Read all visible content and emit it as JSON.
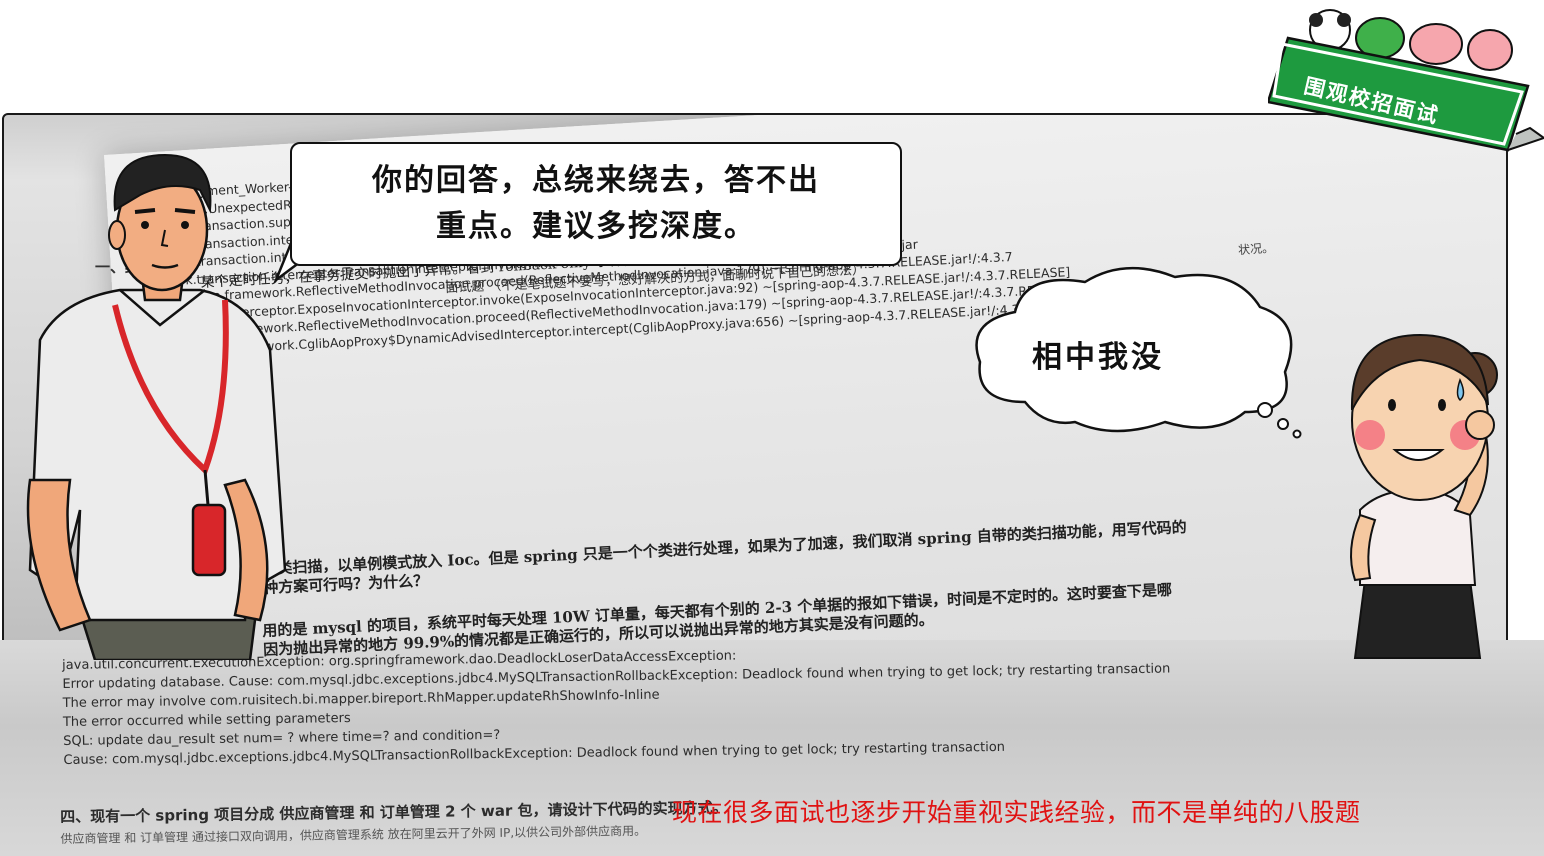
{
  "speech_bubble": {
    "line1": "你的回答，总绕来绕去，答不出",
    "line2": "重点。建议多挖深度。"
  },
  "thought_bubble": {
    "text": "相中我没"
  },
  "badge": {
    "text": "围观校招面试",
    "color": "#1e9a3f"
  },
  "caption": {
    "text": "现在很多面试也逐步开始重视实践经验，而不是单纯的八股题",
    "color": "#e01212"
  },
  "document": {
    "title": "面试题  （不是笔试题不要写，想好解决的方式，面聊时说下自己的想法）",
    "section1_label": "一、结",
    "section1_text": "某个定时任务，在事务提交时抛出了异常。看到 rollback-only 字样，这个是什么原因引起的。写代码",
    "year": "2017",
    "stray_right": "状况。",
    "log_lines": [
      "132 [payment_Worker-2] ERROR com.lianjia.payment.job.bill.BillJobService.execute(BillJobService.java:39) [9000020_26",
      "nsaction.UnexpectedRollbackException: Transaction rolled back because it has been marked as rollback-only",
      "ework.transaction.support.AbstractPlatformTransactionManager.commit(AbstractPlatformTransactionManager.java",
      "ework.transaction.interceptor.TransactionAspectSupport.commitTransactionAfterReturning(TransactionAspectSupp",
      "ework.transaction.interceptor.TransactionAspectSupport.invokeWithinTransaction(TransactionAspectSupport.java:29",
      "ework.transaction.interceptor.TransactionInterceptor.invoke(TransactionInterceptor.java:96) ~[spring-tx-4.3.7.RELEASE.jar",
      "ework.aop.framework.ReflectiveMethodInvocation.proceed(ReflectiveMethodInvocation.java:179) ~[spring-aop-4.3.7.RELEASE.jar!/:4.3.7",
      "ework.aop.interceptor.ExposeInvocationInterceptor.invoke(ExposeInvocationInterceptor.java:92) ~[spring-aop-4.3.7.RELEASE.jar!/:4.3.7.RELEASE]",
      "ework.aop.framework.ReflectiveMethodInvocation.proceed(ReflectiveMethodInvocation.java:179) ~[spring-aop-4.3.7.RELEASE.jar!/:4.3.7.RELEASE]",
      "ework.aop.framework.CglibAopProxy$DynamicAdvisedInterceptor.intercept(CglibAopProxy.java:656) ~[spring-aop-4.3.7.RELEASE.jar!/:4.3.7.RELEASE]"
    ],
    "question2_lines": [
      "做类扫描，以单例模式放入 Ioc。但是 spring 只是一个个类进行处理，如果为了加速，我们取消 spring 自带的类扫描功能，用写代码的",
      "种方案可行吗？为什么？"
    ],
    "question3_lines": [
      "用的是 mysql 的项目，系统平时每天处理 10W 订单量，每天都有个别的 2-3 个单据的报如下错误，时间是不定时的。这时要查下是哪",
      "因为抛出异常的地方 99.9%的情况都是正确运行的，所以可以说抛出异常的地方其实是没有问题的。"
    ],
    "error_lines": [
      "java.util.concurrent.ExecutionException: org.springframework.dao.DeadlockLoserDataAccessException:",
      "    Error updating database.    Cause: com.mysql.jdbc.exceptions.jdbc4.MySQLTransactionRollbackException: Deadlock found when trying to get lock; try restarting transaction",
      "    The error may involve com.ruisitech.bi.mapper.bireport.RhMapper.updateRhShowInfo-Inline",
      "  The error occurred while setting parameters",
      "    SQL: update dau_result      set    num= ?     where time=? and condition=?",
      "    Cause: com.mysql.jdbc.exceptions.jdbc4.MySQLTransactionRollbackException: Deadlock found when trying to get lock; try restarting transaction"
    ],
    "section4_title": "四、现有一个 spring 项目分成 供应商管理 和 订单管理 2 个 war 包，请设计下代码的实现方式。",
    "section4_sub": "供应商管理 和 订单管理 通过接口双向调用，供应商管理系统 放在阿里云开了外网 IP,以供公司外部供应商用。"
  }
}
